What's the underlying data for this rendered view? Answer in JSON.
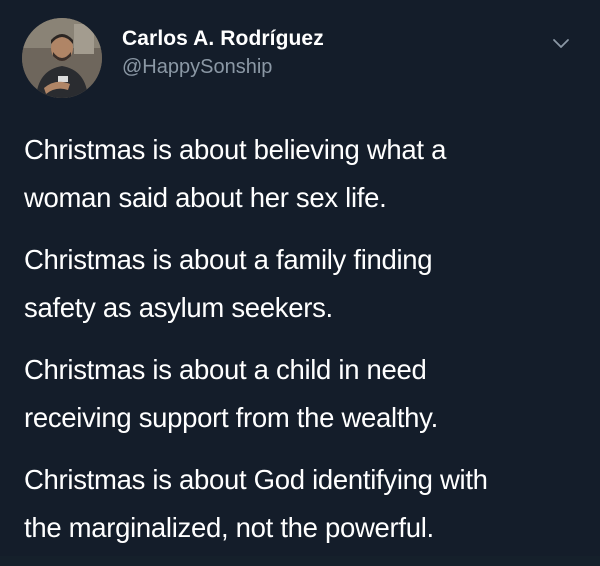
{
  "user": {
    "display_name": "Carlos A. Rodríguez",
    "handle": "@HappySonship",
    "avatar_icon": "profile-photo"
  },
  "menu": {
    "icon": "chevron-down-icon"
  },
  "tweet": {
    "paragraphs": [
      {
        "line1": "Christmas is about believing what a",
        "line2": "woman said about her sex life."
      },
      {
        "line1": "Christmas is about a family finding",
        "line2": "safety as asylum seekers."
      },
      {
        "line1": "Christmas is about a child in need",
        "line2": "receiving support from the wealthy."
      },
      {
        "line1": "Christmas is about God identifying with",
        "line2": "the marginalized, not the powerful."
      }
    ]
  },
  "colors": {
    "background": "#141d2a",
    "primary_text": "#ffffff",
    "secondary_text": "#8b98a5"
  }
}
